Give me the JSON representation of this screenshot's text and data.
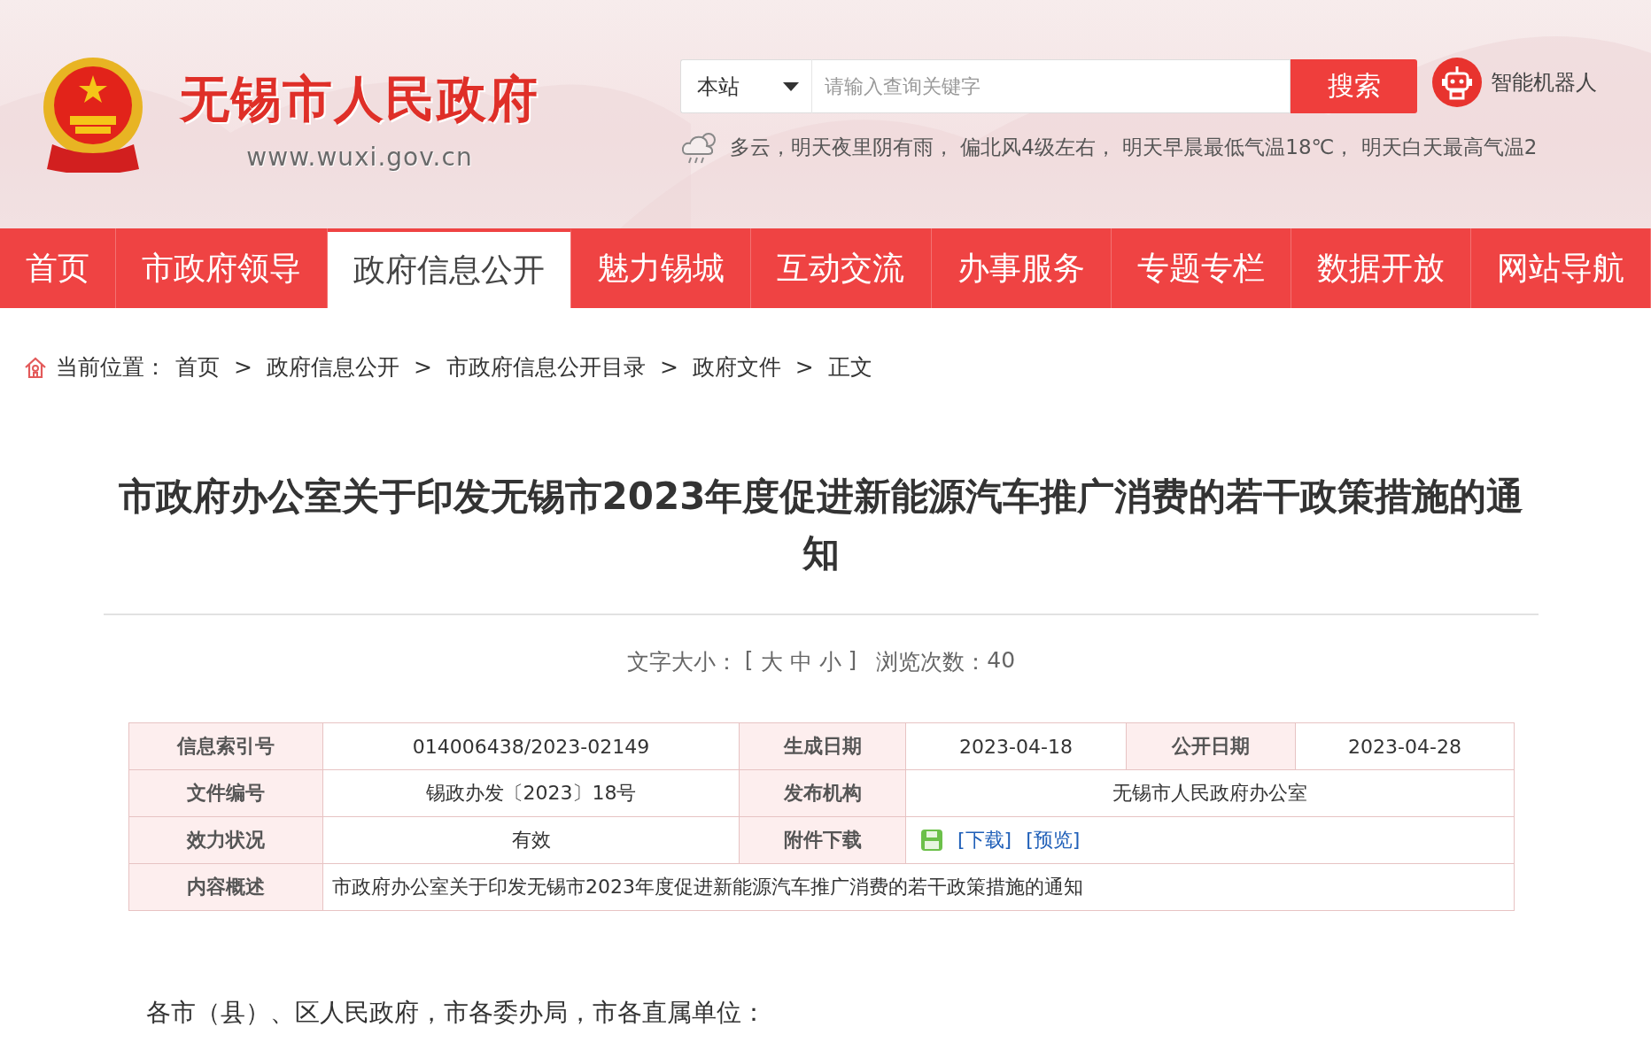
{
  "header": {
    "site_name": "无锡市人民政府",
    "site_url": "www.wuxi.gov.cn",
    "search": {
      "scope": "本站",
      "placeholder": "请输入查询关键字",
      "button": "搜索"
    },
    "robot": "智能机器人",
    "weather": "多云，明天夜里阴有雨， 偏北风4级左右， 明天早晨最低气温18℃， 明天白天最高气温2"
  },
  "nav": [
    {
      "label": "首页",
      "selected": false
    },
    {
      "label": "市政府领导",
      "selected": false
    },
    {
      "label": "政府信息公开",
      "selected": true
    },
    {
      "label": "魅力锡城",
      "selected": false
    },
    {
      "label": "互动交流",
      "selected": false
    },
    {
      "label": "办事服务",
      "selected": false
    },
    {
      "label": "专题专栏",
      "selected": false
    },
    {
      "label": "数据开放",
      "selected": false
    },
    {
      "label": "网站导航",
      "selected": false
    }
  ],
  "breadcrumb": {
    "label": "当前位置：",
    "separator": ">",
    "items": [
      "首页",
      "政府信息公开",
      "市政府信息公开目录",
      "政府文件",
      "正文"
    ]
  },
  "article": {
    "title": "市政府办公室关于印发无锡市2023年度促进新能源汽车推广消费的若干政策措施的通知",
    "font_size": {
      "label": "文字大小：",
      "open": "[",
      "options": [
        "大",
        "中",
        "小"
      ],
      "close": "]"
    },
    "views": {
      "label": "浏览次数：",
      "value": "40"
    },
    "info_table": [
      [
        {
          "kind": "label",
          "text": "信息索引号"
        },
        {
          "kind": "value",
          "text": "014006438/2023-02149"
        },
        {
          "kind": "label",
          "text": "生成日期"
        },
        {
          "kind": "value",
          "text": "2023-04-18"
        },
        {
          "kind": "label",
          "text": "公开日期"
        },
        {
          "kind": "value",
          "text": "2023-04-28"
        }
      ],
      [
        {
          "kind": "label",
          "text": "文件编号"
        },
        {
          "kind": "value",
          "text": "锡政办发〔2023〕18号"
        },
        {
          "kind": "label",
          "text": "发布机构"
        },
        {
          "kind": "value",
          "text": "无锡市人民政府办公室"
        }
      ],
      [
        {
          "kind": "label",
          "text": "效力状况"
        },
        {
          "kind": "value",
          "text": "有效"
        },
        {
          "kind": "label",
          "text": "附件下载"
        },
        {
          "kind": "attachment",
          "links": [
            "[下载]",
            "[预览]"
          ]
        }
      ],
      [
        {
          "kind": "label",
          "text": "内容概述"
        },
        {
          "kind": "text",
          "text": "市政府办公室关于印发无锡市2023年度促进新能源汽车推广消费的若干政策措施的通知"
        }
      ]
    ],
    "paragraphs": [
      "各市（县）、区人民政府，市各委办局，市各直属单位："
    ]
  }
}
